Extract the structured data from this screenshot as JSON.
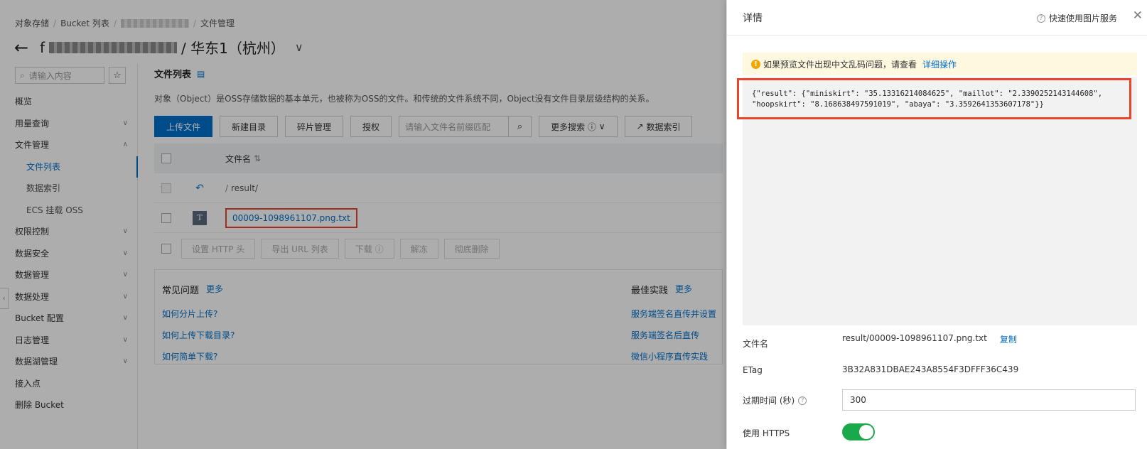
{
  "breadcrumb": {
    "items": [
      "对象存储",
      "Bucket 列表",
      "文件管理"
    ]
  },
  "header": {
    "title_prefix": "f",
    "title_suffix": "/ 华东1（杭州）"
  },
  "sidebar": {
    "search_placeholder": "请输入内容",
    "items": [
      {
        "label": "概览"
      },
      {
        "label": "用量查询",
        "caret": "∨"
      },
      {
        "label": "文件管理",
        "caret": "∧"
      },
      {
        "label": "文件列表"
      },
      {
        "label": "数据索引"
      },
      {
        "label": "ECS 挂载 OSS"
      },
      {
        "label": "权限控制",
        "caret": "∨"
      },
      {
        "label": "数据安全",
        "caret": "∨"
      },
      {
        "label": "数据管理",
        "caret": "∨"
      },
      {
        "label": "数据处理",
        "caret": "∨"
      },
      {
        "label": "Bucket 配置",
        "caret": "∨"
      },
      {
        "label": "日志管理",
        "caret": "∨"
      },
      {
        "label": "数据湖管理",
        "caret": "∨"
      },
      {
        "label": "接入点"
      },
      {
        "label": "删除 Bucket"
      }
    ]
  },
  "main": {
    "section_title": "文件列表",
    "description": "对象（Object）是OSS存储数据的基本单元，也被称为OSS的文件。和传统的文件系统不同，Object没有文件目录层级结构的关系。",
    "toolbar": {
      "upload": "上传文件",
      "new_dir": "新建目录",
      "fragments": "碎片管理",
      "authorize": "授权",
      "search_placeholder": "请输入文件名前缀匹配",
      "more_search": "更多搜索",
      "data_index": "数据索引"
    },
    "table": {
      "col_name": "文件名",
      "parent_path": "result/",
      "file_name": "00009-1098961107.png.txt",
      "file_icon": "T"
    },
    "batch": [
      "设置 HTTP 头",
      "导出 URL 列表",
      "下载",
      "解冻",
      "彻底删除"
    ],
    "help": {
      "faq_title": "常见问题",
      "faq_more": "更多",
      "faq_links": [
        "如何分片上传?",
        "如何上传下载目录?",
        "如何简单下载?"
      ],
      "best_title": "最佳实践",
      "best_more": "更多",
      "best_links": [
        "服务端签名直传并设置",
        "服务端签名后直传",
        "微信小程序直传实践"
      ]
    }
  },
  "drawer": {
    "title": "详情",
    "help_link": "快速使用图片服务",
    "warning_text": "如果预览文件出现中文乱码问题，请查看",
    "warning_link": "详细操作",
    "preview_line1": "{\"result\": {\"miniskirt\": \"35.13316214084625\", \"maillot\": \"2.3390252143144608\",",
    "preview_line2": "\"hoopskirt\": \"8.168638497591019\", \"abaya\": \"3.3592641353607178\"}}",
    "filename_label": "文件名",
    "filename_value": "result/00009-1098961107.png.txt",
    "copy_label": "复制",
    "etag_label": "ETag",
    "etag_value": "3B32A831DBAE243A8554F3DFFF36C439",
    "expire_label": "过期时间 (秒)",
    "expire_value": "300",
    "https_label": "使用 HTTPS",
    "https_enabled": true,
    "toggle_color": "#19a84a"
  },
  "colors": {
    "primary": "#0070cc",
    "highlight": "#e8452c",
    "warning_bg": "#fff8e0"
  }
}
